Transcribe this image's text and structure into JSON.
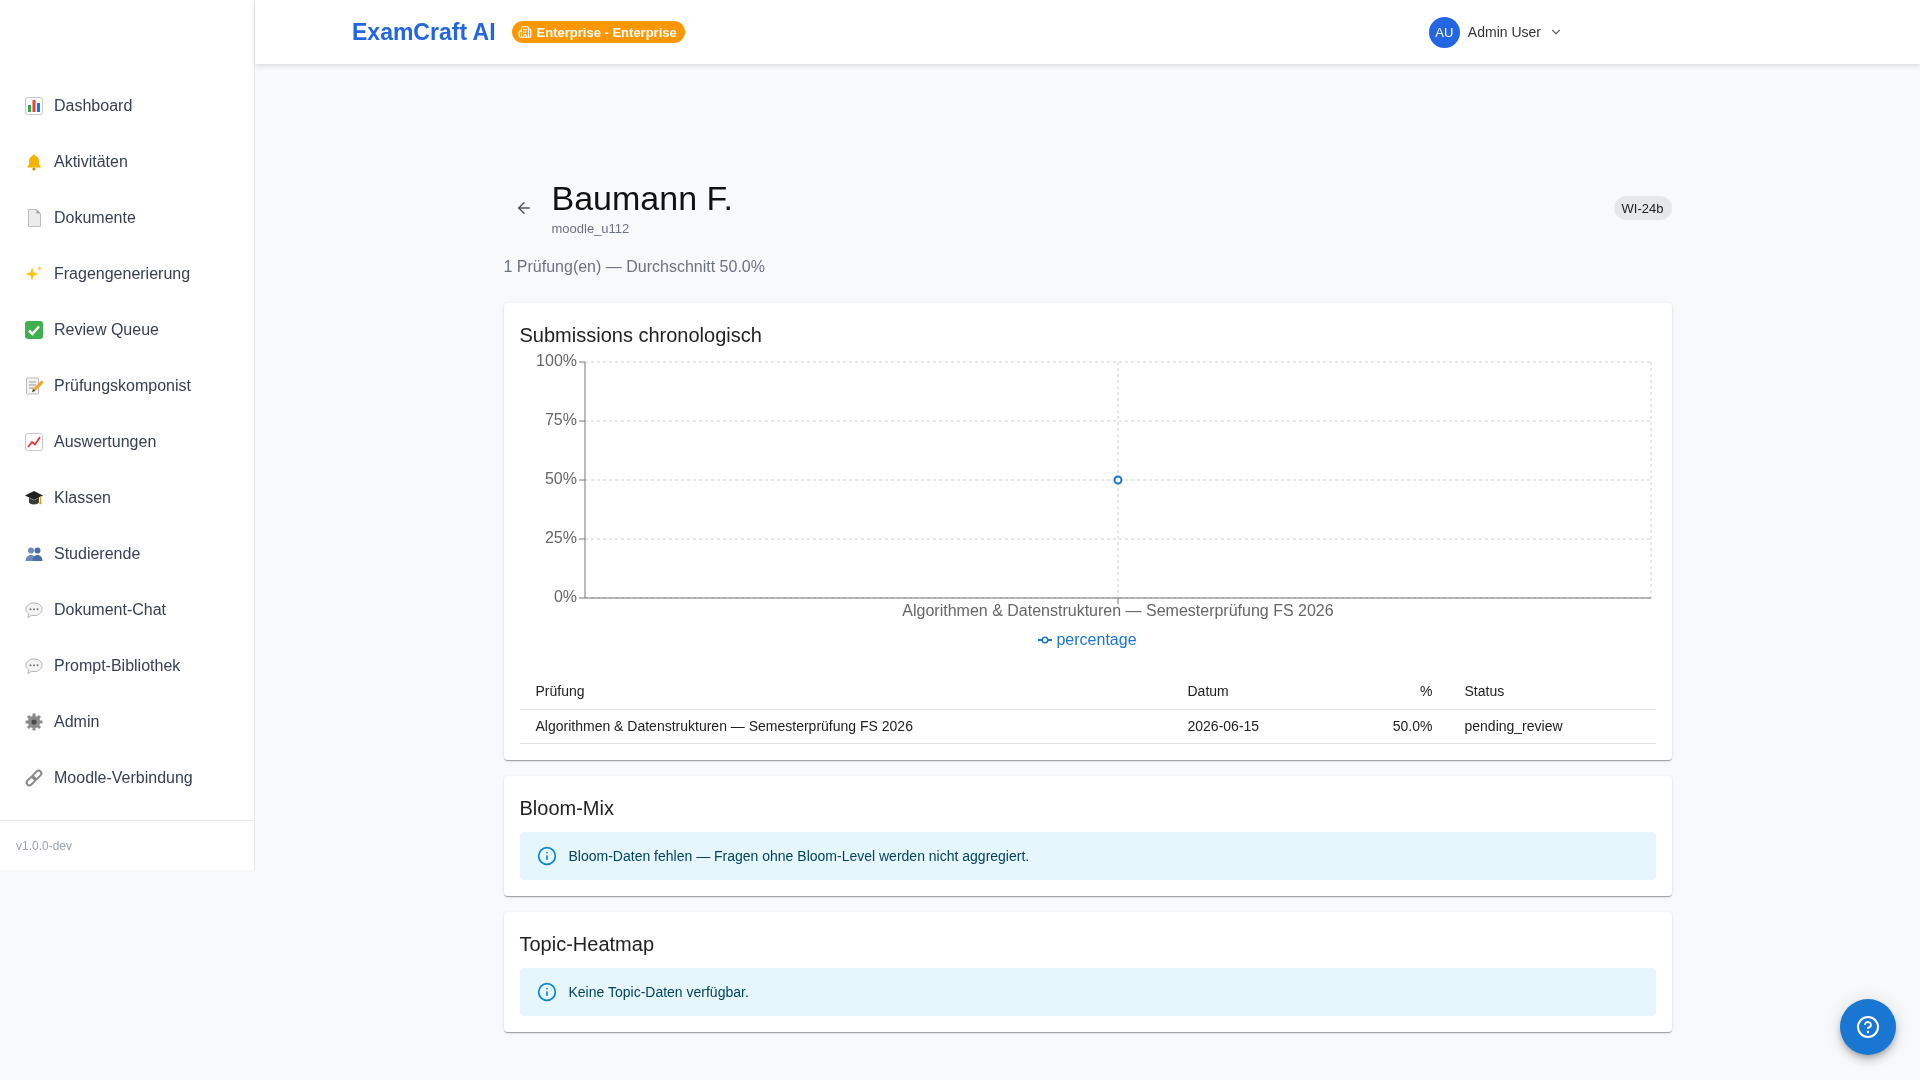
{
  "header": {
    "logo": "ExamCraft AI",
    "plan_badge": "Enterprise - Enterprise",
    "user": {
      "initials": "AU",
      "name": "Admin User"
    }
  },
  "sidebar": {
    "items": [
      {
        "label": "Dashboard",
        "selected": false
      },
      {
        "label": "Aktivitäten",
        "selected": false
      },
      {
        "label": "Dokumente",
        "selected": false
      },
      {
        "label": "Fragengenerierung",
        "selected": false
      },
      {
        "label": "Review Queue",
        "selected": false
      },
      {
        "label": "Prüfungskomponist",
        "selected": false
      },
      {
        "label": "Auswertungen",
        "selected": false
      },
      {
        "label": "Klassen",
        "selected": false
      },
      {
        "label": "Studierende",
        "selected": false
      },
      {
        "label": "Dokument-Chat",
        "selected": false
      },
      {
        "label": "Prompt-Bibliothek",
        "selected": false
      },
      {
        "label": "Admin",
        "selected": false
      },
      {
        "label": "Moodle-Verbindung",
        "selected": false
      }
    ],
    "version": "v1.0.0-dev"
  },
  "student": {
    "name": "Baumann F.",
    "username": "moodle_u112",
    "class_chip": "WI-24b",
    "summary": "1 Prüfung(en) — Durchschnitt 50.0%"
  },
  "submissions": {
    "title": "Submissions chronologisch",
    "chart_data": {
      "type": "line",
      "grid": true,
      "categories": [
        "Algorithmen & Datenstrukturen — Semesterprüfung FS 2026"
      ],
      "series": [
        {
          "name": "percentage",
          "color": "#1976d2",
          "marker": true,
          "values": [
            50
          ]
        }
      ],
      "ylim": [
        0,
        100
      ],
      "yticks": [
        {
          "value": 0,
          "label": "0%"
        },
        {
          "value": 25,
          "label": "25%"
        },
        {
          "value": 50,
          "label": "50%"
        },
        {
          "value": 75,
          "label": "75%"
        },
        {
          "value": 100,
          "label": "100%"
        }
      ]
    },
    "table": {
      "columns": [
        "Prüfung",
        "Datum",
        "%",
        "Status"
      ],
      "rows": [
        [
          "Algorithmen & Datenstrukturen — Semesterprüfung FS 2026",
          "2026-06-15",
          "50.0%",
          "pending_review"
        ]
      ]
    }
  },
  "bloom_mix": {
    "title": "Bloom-Mix",
    "alert": "Bloom-Daten fehlen — Fragen ohne Bloom-Level werden nicht aggregiert."
  },
  "topic_heatmap": {
    "title": "Topic-Heatmap",
    "alert": "Keine Topic-Daten verfügbar."
  }
}
